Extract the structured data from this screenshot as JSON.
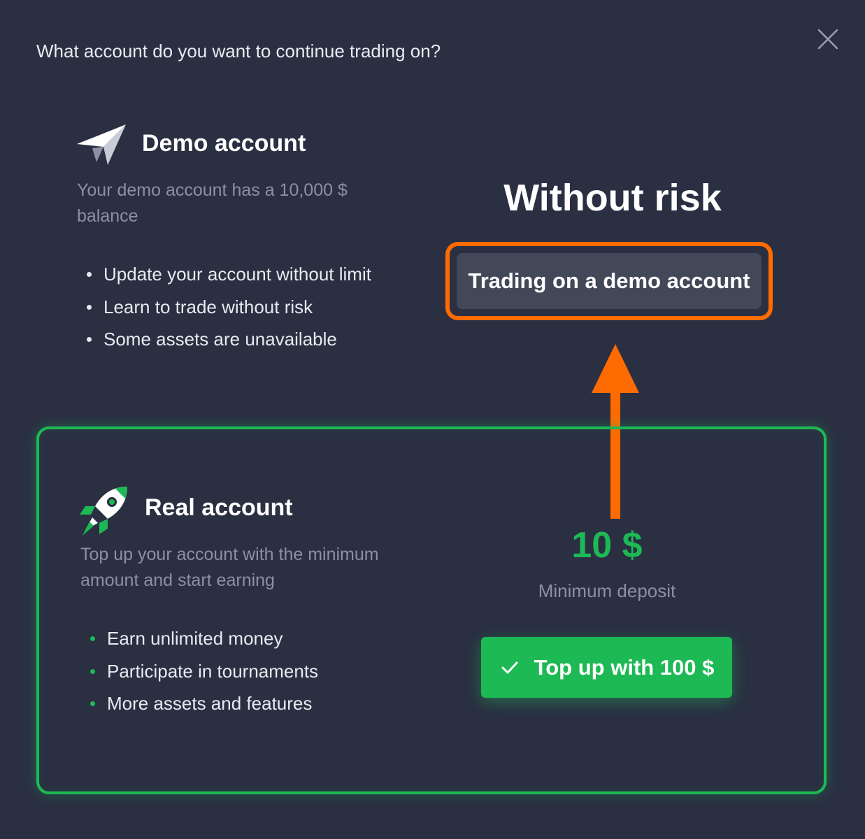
{
  "dialog": {
    "question": "What account do you want to continue trading on?",
    "close_icon": "close-icon"
  },
  "demo": {
    "icon": "paper-plane-icon",
    "title": "Demo account",
    "description": "Your demo account has a 10,000 $ balance",
    "features": [
      "Update your account without limit",
      "Learn to trade without risk",
      "Some assets are unavailable"
    ],
    "headline": "Without risk",
    "button_label": "Trading on a demo account",
    "highlight_color": "#ff6b00"
  },
  "real": {
    "icon": "rocket-icon",
    "title": "Real account",
    "description": "Top up your account with the minimum amount and start earning",
    "features": [
      "Earn unlimited money",
      "Participate in tournaments",
      "More assets and features"
    ],
    "min_amount": "10 $",
    "min_label": "Minimum deposit",
    "button_label": "Top up with 100 $",
    "accent_color": "#1db954"
  },
  "annotation": {
    "arrow_icon": "arrow-up-icon",
    "arrow_color": "#ff6b00"
  }
}
